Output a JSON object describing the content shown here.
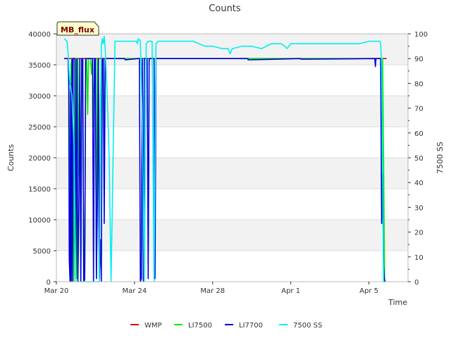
{
  "chart_data": {
    "type": "line",
    "title": "Counts",
    "xlabel": "Time",
    "ylabel": "Counts",
    "y2label": "7500 SS",
    "site_label": "MB_flux",
    "xlim": [
      0,
      18
    ],
    "ylim": [
      0,
      40000
    ],
    "y2lim": [
      0,
      100
    ],
    "x_ticks": [
      {
        "value": 0,
        "label": "Mar 20"
      },
      {
        "value": 4,
        "label": "Mar 24"
      },
      {
        "value": 8,
        "label": "Mar 28"
      },
      {
        "value": 12,
        "label": "Apr 1"
      },
      {
        "value": 16,
        "label": "Apr 5"
      }
    ],
    "y_ticks": [
      0,
      5000,
      10000,
      15000,
      20000,
      25000,
      30000,
      35000,
      40000
    ],
    "y2_ticks": [
      0,
      10,
      20,
      30,
      40,
      50,
      60,
      70,
      80,
      90,
      100
    ],
    "bands": "alternating light grey",
    "legend_position": "bottom",
    "series": [
      {
        "name": "WMP",
        "color": "#dd0000",
        "axis": "left",
        "x": [
          0.4,
          16.9
        ],
        "y": [
          36000,
          36000
        ]
      },
      {
        "name": "LI7500",
        "color": "#00ee00",
        "axis": "left",
        "x": [
          0.4,
          0.6,
          0.65,
          0.7,
          0.75,
          0.8,
          0.85,
          0.9,
          0.95,
          1.0,
          1.05,
          1.1,
          1.15,
          1.2,
          1.25,
          1.3,
          1.35,
          1.4,
          1.45,
          1.5,
          1.55,
          1.6,
          1.65,
          1.7,
          1.75,
          1.8,
          1.85,
          1.9,
          1.95,
          2.0,
          2.05,
          2.1,
          2.15,
          2.2,
          2.25,
          2.3,
          2.35,
          2.4,
          2.45,
          2.5,
          2.55,
          2.6,
          2.65,
          2.7,
          2.75,
          16.7,
          16.75,
          16.8,
          16.85
        ],
        "y": [
          36000,
          36000,
          30000,
          500,
          35000,
          36000,
          24000,
          0,
          36000,
          36000,
          500,
          36000,
          17000,
          29500,
          0,
          36000,
          36000,
          0,
          0,
          36000,
          36000,
          27000,
          36000,
          36000,
          36000,
          33500,
          36000,
          25000,
          36000,
          36000,
          500,
          36000,
          36000,
          500,
          28000,
          36000,
          36000,
          36000,
          20000,
          36000,
          36000,
          36000,
          36000,
          36000,
          36000,
          36000,
          20000,
          500,
          0
        ]
      },
      {
        "name": "LI7700",
        "color": "#0000dd",
        "axis": "left",
        "x": [
          0.4,
          0.6,
          0.63,
          0.66,
          0.7,
          0.73,
          0.76,
          0.8,
          0.83,
          0.86,
          0.9,
          0.95,
          1.0,
          1.05,
          1.1,
          1.15,
          1.2,
          1.25,
          1.3,
          1.35,
          1.4,
          1.45,
          1.5,
          1.55,
          1.6,
          1.65,
          1.7,
          1.75,
          1.8,
          1.85,
          1.9,
          1.95,
          2.0,
          2.05,
          2.1,
          2.15,
          2.2,
          2.25,
          2.3,
          2.35,
          2.4,
          2.45,
          2.5,
          2.55,
          2.6,
          2.65,
          2.7,
          2.75,
          3.5,
          3.52,
          4.2,
          4.25,
          4.3,
          4.35,
          4.4,
          4.45,
          4.5,
          4.55,
          4.6,
          4.65,
          4.7,
          4.75,
          4.8,
          4.85,
          4.9,
          4.95,
          5.0,
          5.05,
          5.1,
          5.15,
          5.2,
          9.8,
          9.82,
          12.5,
          12.52,
          16.3,
          16.33,
          16.36,
          16.4,
          16.55,
          16.6,
          16.65,
          16.7,
          16.75,
          16.8,
          16.85
        ],
        "y": [
          36000,
          36000,
          33000,
          3500,
          0,
          32000,
          0,
          36000,
          0,
          36000,
          36000,
          36000,
          500,
          36000,
          0,
          12000,
          36000,
          0,
          36000,
          36000,
          0,
          500,
          36000,
          36000,
          36000,
          36000,
          36000,
          36000,
          36000,
          36000,
          0,
          36000,
          36000,
          500,
          12800,
          36000,
          500,
          6800,
          0,
          36000,
          36000,
          9400,
          36000,
          36000,
          36000,
          36000,
          36000,
          36000,
          36000,
          35800,
          36000,
          36000,
          0,
          500,
          36000,
          0,
          36000,
          36000,
          36000,
          36000,
          500,
          36000,
          36000,
          36000,
          36000,
          36000,
          36000,
          500,
          36000,
          36000,
          36000,
          36000,
          35800,
          36000,
          35900,
          36000,
          34700,
          36000,
          36000,
          36000,
          36000,
          9400,
          17500,
          2600,
          0,
          0
        ]
      },
      {
        "name": "7500 SS",
        "color": "#00f0f0",
        "axis": "right",
        "x": [
          0.4,
          0.55,
          0.6,
          0.65,
          0.7,
          0.8,
          0.9,
          1.0,
          1.2,
          1.5,
          1.8,
          1.9,
          1.95,
          2.0,
          2.1,
          2.2,
          2.3,
          2.35,
          2.4,
          2.45,
          2.5,
          2.55,
          2.6,
          2.7,
          2.8,
          3.0,
          3.3,
          3.6,
          3.9,
          4.1,
          4.15,
          4.2,
          4.3,
          4.4,
          4.5,
          4.6,
          4.7,
          4.8,
          4.9,
          5.0,
          5.1,
          5.2,
          5.3,
          5.6,
          6.0,
          6.5,
          7.0,
          7.3,
          7.6,
          8.0,
          8.5,
          8.8,
          8.9,
          9.0,
          9.5,
          10.0,
          10.5,
          11.0,
          11.5,
          11.7,
          11.8,
          12.0,
          12.5,
          13.0,
          13.5,
          14.0,
          14.5,
          15.0,
          15.5,
          16.0,
          16.2,
          16.4,
          16.5,
          16.55,
          16.6,
          16.65,
          16.7,
          16.75,
          16.8
        ],
        "y": [
          98,
          97,
          92,
          85,
          80,
          75,
          55,
          0,
          0,
          0,
          0,
          0,
          0,
          0,
          0,
          0,
          95,
          98,
          96,
          99,
          94,
          85,
          75,
          50,
          0,
          97,
          97,
          97,
          97,
          97,
          96,
          98,
          97,
          65,
          0,
          96,
          97,
          97,
          97,
          0,
          96,
          97,
          97,
          97,
          97,
          97,
          97,
          96,
          95,
          95,
          94,
          94,
          92,
          94,
          95,
          95,
          94,
          96,
          96,
          95,
          94,
          96,
          96,
          96,
          96,
          96,
          96,
          96,
          96,
          97,
          97,
          97,
          97,
          97,
          96,
          88,
          40,
          0,
          0
        ]
      }
    ]
  }
}
